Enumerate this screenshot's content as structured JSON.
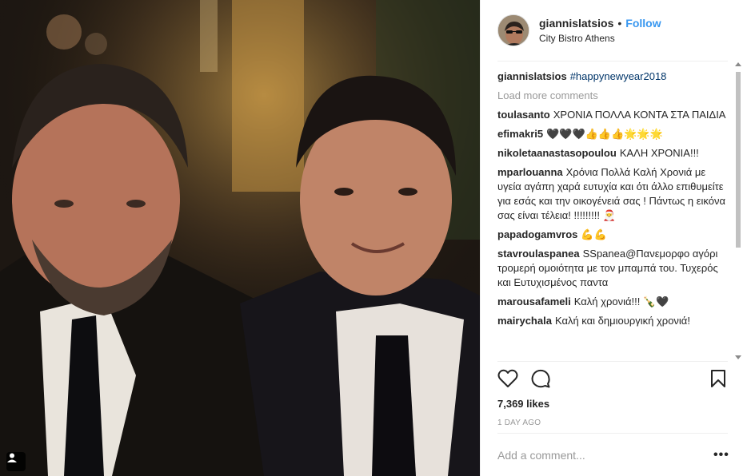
{
  "post": {
    "username": "giannislatsios",
    "follow_label": "Follow",
    "separator": "•",
    "location": "City Bistro Athens"
  },
  "caption": {
    "username": "giannislatsios",
    "text": "#happynewyear2018"
  },
  "load_more_label": "Load more comments",
  "comments": [
    {
      "user": "toulasanto",
      "text": "ΧΡΟΝΙΑ ΠΟΛΛΑ ΚΟΝΤΑ ΣΤΑ ΠΑΙΔΙΑ"
    },
    {
      "user": "efimakri5",
      "text": "🖤🖤🖤👍👍👍🌟🌟🌟"
    },
    {
      "user": "nikoletaanastasopoulou",
      "text": "ΚΑΛΗ ΧΡΟΝΙΑ!!!"
    },
    {
      "user": "mparlouanna",
      "text": "Χρόνια Πολλά Καλή Χρονιά με υγεία αγάπη χαρά ευτυχία και ότι άλλο επιθυμείτε για εσάς και την οικογένειά σας ! Πάντως η εικόνα σας είναι τέλεια! !!!!!!!!! 🎅"
    },
    {
      "user": "papadogamvros",
      "text": "💪💪"
    },
    {
      "user": "stavroulaspanea",
      "text": "SSpanea@Πανεμορφο αγόρι τρομερή ομοιότητα με τον μπαμπά του. Τυχερός και Ευτυχισμένος παντα"
    },
    {
      "user": "marousafameli",
      "text": "Καλή χρονιά!!! 🍾🖤"
    },
    {
      "user": "mairychala",
      "text": "Καλή και δημιουργική χρονιά!"
    }
  ],
  "likes": "7,369 likes",
  "timestamp": "1 DAY AGO",
  "add_comment_placeholder": "Add a comment...",
  "more_options": "•••",
  "icons": {
    "like": "heart-outline-icon",
    "comment": "speech-bubble-icon",
    "save": "bookmark-icon",
    "tag": "user-tag-icon"
  },
  "colors": {
    "link": "#3897f0",
    "hashtag": "#003569",
    "muted": "#999999",
    "text": "#262626"
  }
}
